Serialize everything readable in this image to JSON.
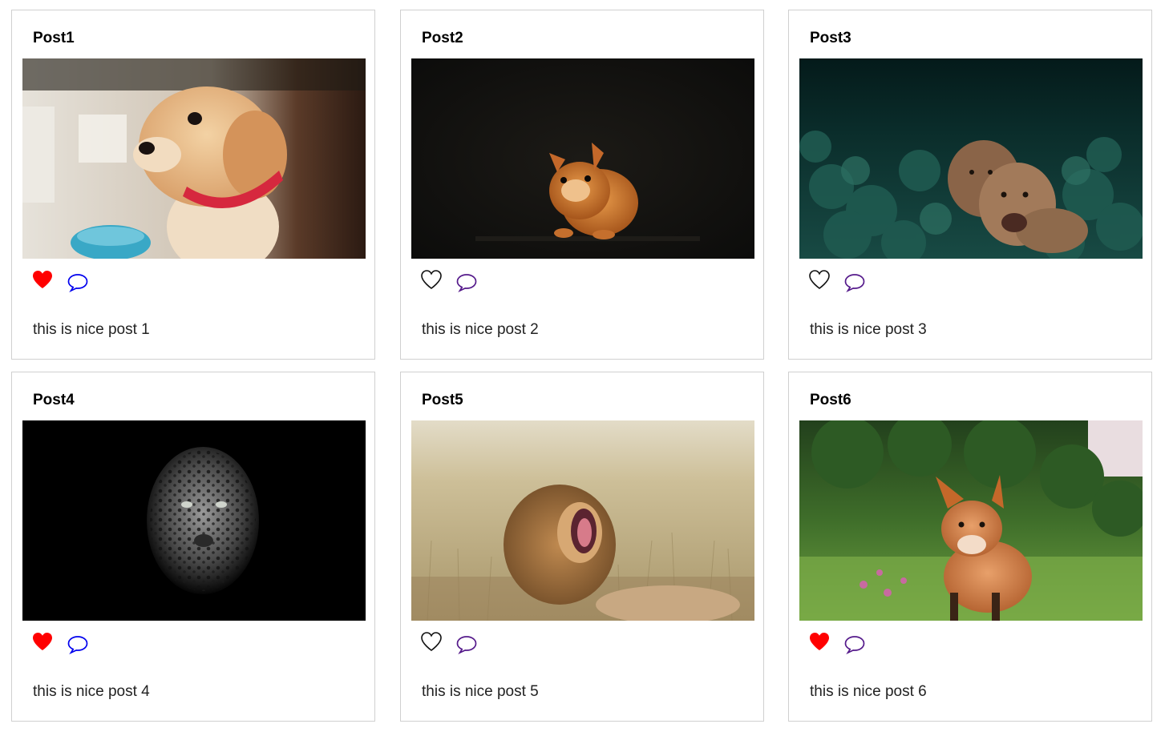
{
  "colors": {
    "liked": "#ff0000",
    "unliked_stroke": "#111111",
    "comment_blue": "#0000ee",
    "comment_purple": "#551a8b"
  },
  "posts": [
    {
      "title": "Post1",
      "caption": "this is nice post 1",
      "liked": true,
      "comment_color": "blue",
      "image": "golden-retriever-puppy"
    },
    {
      "title": "Post2",
      "caption": "this is nice post 2",
      "liked": false,
      "comment_color": "purple",
      "image": "red-squirrel"
    },
    {
      "title": "Post3",
      "caption": "this is nice post 3",
      "liked": false,
      "comment_color": "purple",
      "image": "two-lionesses"
    },
    {
      "title": "Post4",
      "caption": "this is nice post 4",
      "liked": true,
      "comment_color": "blue",
      "image": "black-leopard"
    },
    {
      "title": "Post5",
      "caption": "this is nice post 5",
      "liked": false,
      "comment_color": "purple",
      "image": "yawning-lion"
    },
    {
      "title": "Post6",
      "caption": "this is nice post 6",
      "liked": true,
      "comment_color": "purple",
      "image": "red-fox"
    }
  ]
}
